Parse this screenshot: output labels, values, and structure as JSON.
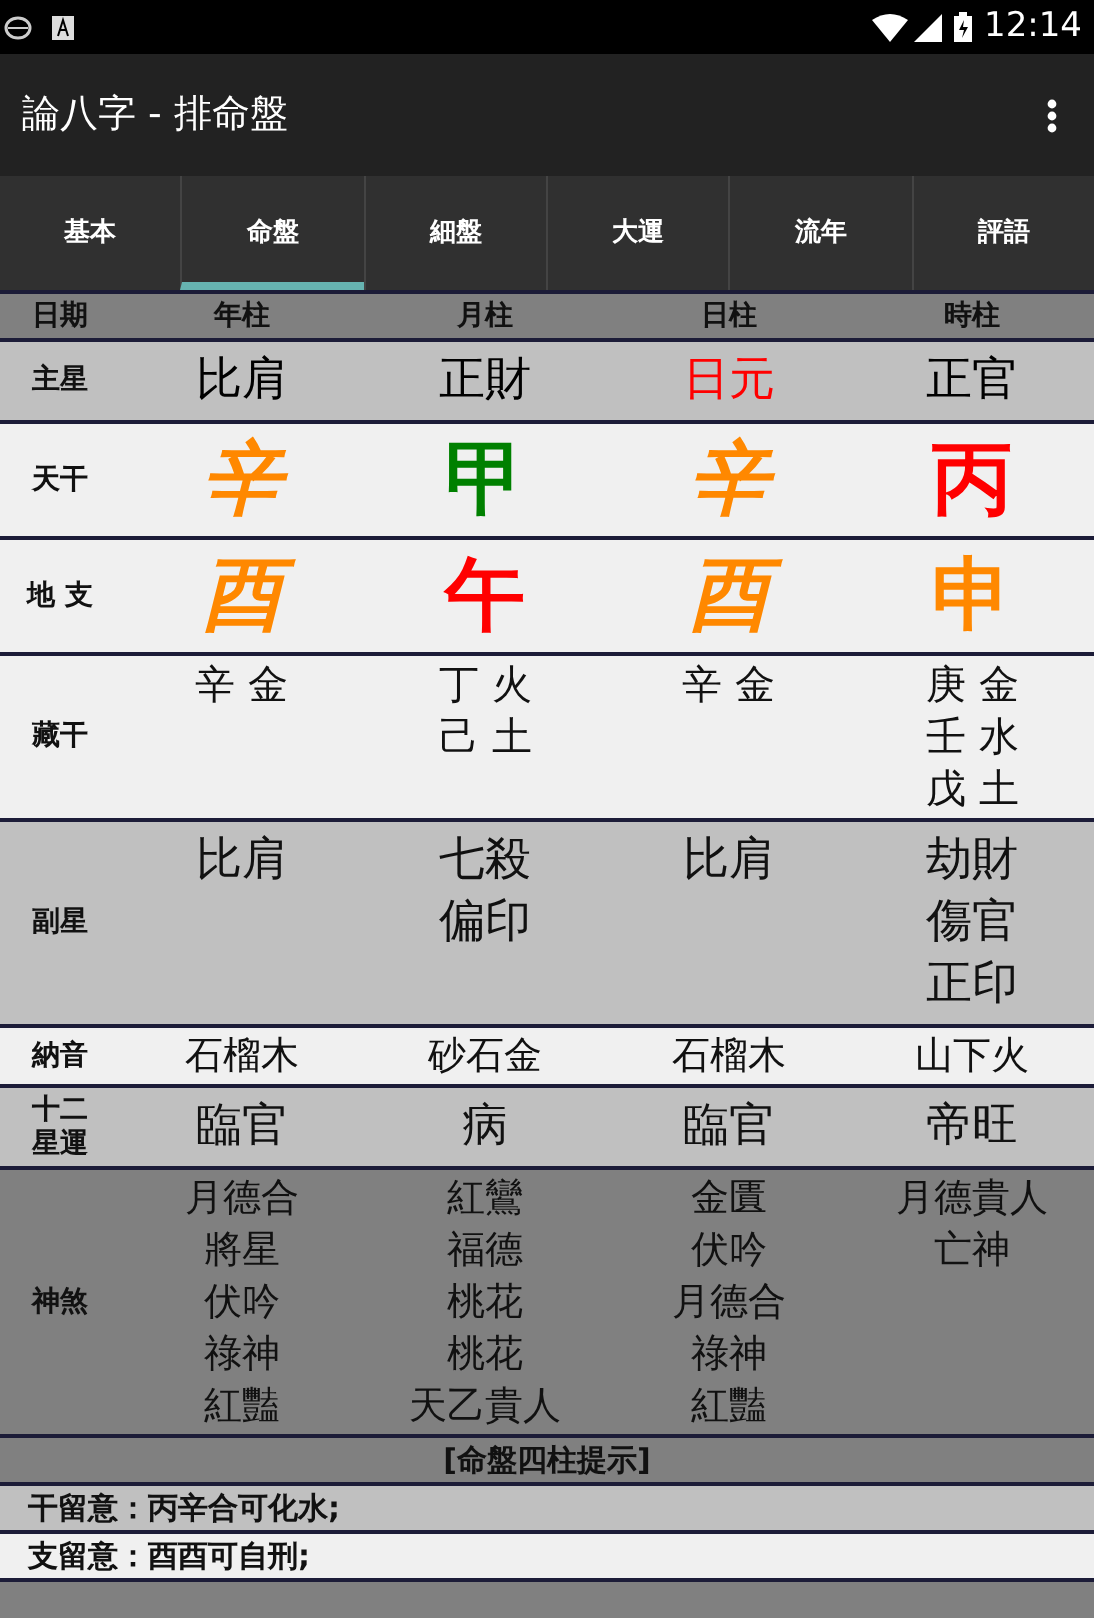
{
  "status_bar": {
    "time": "12:14"
  },
  "app_bar": {
    "title": "論八字 - 排命盤"
  },
  "tabs": [
    {
      "label": "基本",
      "selected": false
    },
    {
      "label": "命盤",
      "selected": true
    },
    {
      "label": "細盤",
      "selected": false
    },
    {
      "label": "大運",
      "selected": false
    },
    {
      "label": "流年",
      "selected": false
    },
    {
      "label": "評語",
      "selected": false
    }
  ],
  "chart": {
    "corner": "日期",
    "columns": [
      "年柱",
      "月柱",
      "日柱",
      "時柱"
    ],
    "rows": [
      {
        "kind": "star",
        "color": "#c0c0c0",
        "label": "主星",
        "cells": [
          {
            "lines": [
              "比肩"
            ],
            "color": "#000000"
          },
          {
            "lines": [
              "正財"
            ],
            "color": "#000000"
          },
          {
            "lines": [
              "日元"
            ],
            "color": "#ff0000"
          },
          {
            "lines": [
              "正官"
            ],
            "color": "#000000"
          }
        ]
      },
      {
        "kind": "pillar",
        "color": "#f0f0f0",
        "label": "天干",
        "cells": [
          {
            "lines": [
              "辛"
            ],
            "color": "#ff8800",
            "italic": true
          },
          {
            "lines": [
              "甲"
            ],
            "color": "#008000",
            "italic": false
          },
          {
            "lines": [
              "辛"
            ],
            "color": "#ff8800",
            "italic": true
          },
          {
            "lines": [
              "丙"
            ],
            "color": "#ff0000",
            "italic": false
          }
        ]
      },
      {
        "kind": "pillar",
        "color": "#f0f0f0",
        "label": "地 支",
        "cells": [
          {
            "lines": [
              "酉"
            ],
            "color": "#ff8800",
            "italic": true
          },
          {
            "lines": [
              "午"
            ],
            "color": "#ff0000",
            "italic": false
          },
          {
            "lines": [
              "酉"
            ],
            "color": "#ff8800",
            "italic": true
          },
          {
            "lines": [
              "申"
            ],
            "color": "#ff8800",
            "italic": false
          }
        ]
      },
      {
        "kind": "hidden",
        "color": "#f0f0f0",
        "label": "藏干",
        "cells": [
          {
            "lines": [
              "辛 金"
            ]
          },
          {
            "lines": [
              "丁 火",
              "己 土"
            ]
          },
          {
            "lines": [
              "辛 金"
            ]
          },
          {
            "lines": [
              "庚 金",
              "壬 水",
              "戊 土"
            ]
          }
        ]
      },
      {
        "kind": "star",
        "color": "#c0c0c0",
        "label": "副星",
        "cells": [
          {
            "lines": [
              "比肩"
            ]
          },
          {
            "lines": [
              "七殺",
              "偏印"
            ]
          },
          {
            "lines": [
              "比肩"
            ]
          },
          {
            "lines": [
              "劫財",
              "傷官",
              "正印"
            ]
          }
        ]
      },
      {
        "kind": "text",
        "color": "#f0f0f0",
        "label": "納音",
        "cells": [
          {
            "lines": [
              "石榴木"
            ]
          },
          {
            "lines": [
              "砂石金"
            ]
          },
          {
            "lines": [
              "石榴木"
            ]
          },
          {
            "lines": [
              "山下火"
            ]
          }
        ]
      },
      {
        "kind": "star",
        "color": "#c0c0c0",
        "label": "十二星運",
        "cells": [
          {
            "lines": [
              "臨官"
            ]
          },
          {
            "lines": [
              "病"
            ]
          },
          {
            "lines": [
              "臨官"
            ]
          },
          {
            "lines": [
              "帝旺"
            ]
          }
        ]
      },
      {
        "kind": "text",
        "color": "#808080",
        "label": "神煞",
        "cells": [
          {
            "lines": [
              "月德合",
              "將星",
              "伏吟",
              "祿神",
              "紅豔"
            ]
          },
          {
            "lines": [
              "紅鸞",
              "福德",
              "桃花",
              "桃花",
              "天乙貴人"
            ]
          },
          {
            "lines": [
              "金匱",
              "伏吟",
              "月德合",
              "祿神",
              "紅豔"
            ]
          },
          {
            "lines": [
              "月德貴人",
              "亡神"
            ]
          }
        ]
      }
    ]
  },
  "notes": {
    "title": "[命盤四柱提示]",
    "lines": [
      {
        "text": "干留意：丙辛合可化水;",
        "color": "#c0c0c0"
      },
      {
        "text": "支留意：酉酉可自刑;",
        "color": "#f0f0f0"
      }
    ]
  }
}
